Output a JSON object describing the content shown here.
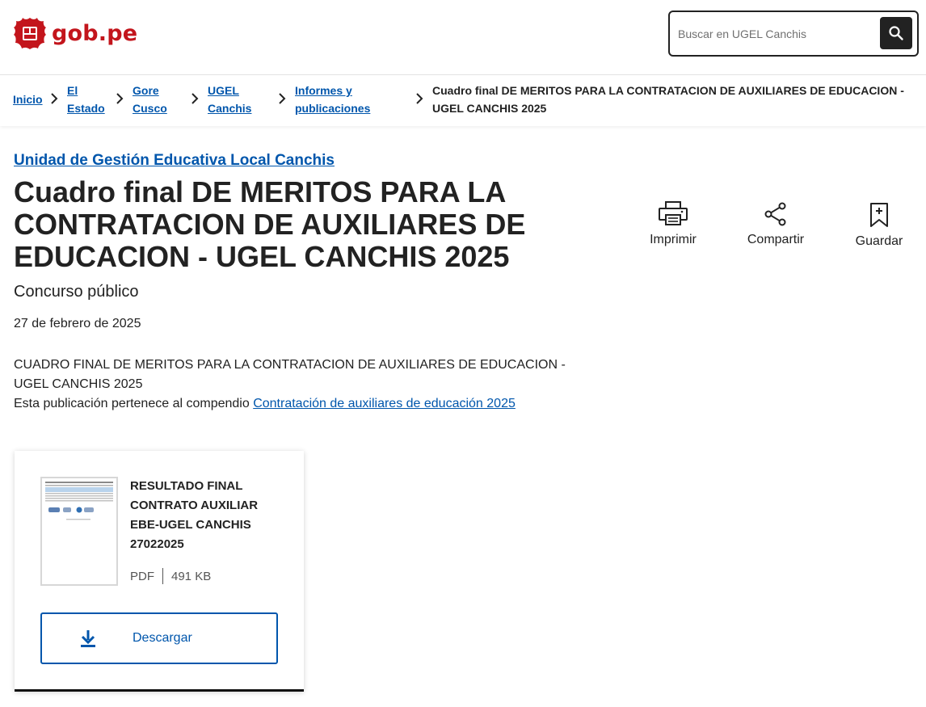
{
  "header": {
    "logo_text": "gob.pe",
    "search": {
      "placeholder": "Buscar en UGEL Canchis",
      "value": ""
    }
  },
  "breadcrumb": {
    "items": [
      {
        "line1": "Inicio",
        "line2": ""
      },
      {
        "line1": "El",
        "line2": "Estado"
      },
      {
        "line1": "Gore",
        "line2": "Cusco"
      },
      {
        "line1": "UGEL",
        "line2": "Canchis"
      },
      {
        "line1": "Informes y",
        "line2": "publicaciones"
      }
    ],
    "current": "Cuadro final DE MERITOS PARA LA CONTRATACION DE AUXILIARES DE EDUCACION - UGEL CANCHIS 2025"
  },
  "main": {
    "organization": "Unidad de Gestión Educativa Local Canchis",
    "title": "Cuadro final DE MERITOS PARA LA CONTRATACION DE AUXILIARES DE EDUCACION - UGEL CANCHIS 2025",
    "subtitle": "Concurso público",
    "date": "27 de febrero de 2025",
    "description": "CUADRO FINAL DE MERITOS PARA LA CONTRATACION DE AUXILIARES DE EDUCACION - UGEL CANCHIS 2025",
    "compendio_prefix": "Esta publicación pertenece al compendio",
    "compendio_link": "Contratación de auxiliares de educación 2025"
  },
  "actions": {
    "print_label": "Imprimir",
    "share_label": "Compartir",
    "save_label": "Guardar"
  },
  "document": {
    "title": "RESULTADO FINAL CONTRATO AUXILIAR EBE-UGEL CANCHIS 27022025",
    "format": "PDF",
    "size": "491 KB",
    "download_label": "Descargar"
  },
  "colors": {
    "brand_red": "#c3151c",
    "link_blue": "#0056ac",
    "text_dark": "#222222"
  }
}
